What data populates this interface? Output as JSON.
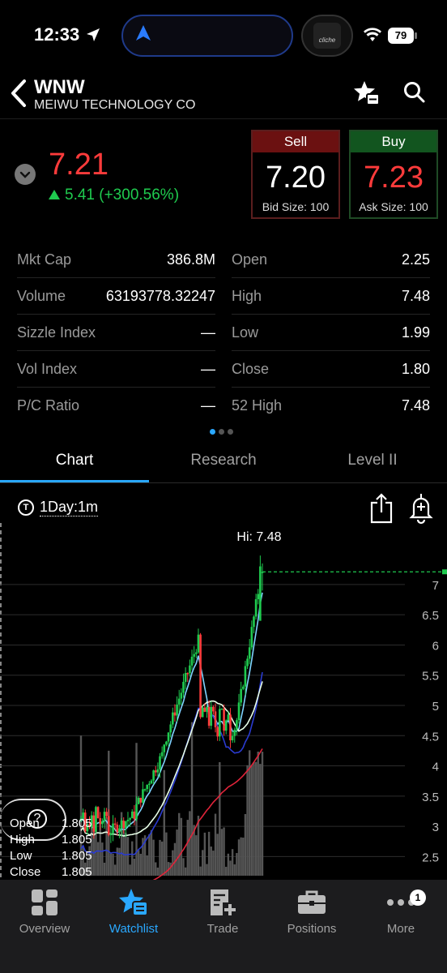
{
  "status_bar": {
    "time": "12:33",
    "battery": "79"
  },
  "header": {
    "symbol": "WNW",
    "company": "MEIWU TECHNOLOGY CO"
  },
  "quote": {
    "last": "7.21",
    "change": "5.41 (+300.56%)",
    "sell": {
      "label": "Sell",
      "price": "7.20",
      "size": "Bid Size: 100"
    },
    "buy": {
      "label": "Buy",
      "price": "7.23",
      "size": "Ask Size: 100"
    }
  },
  "stats": {
    "left": [
      {
        "label": "Mkt Cap",
        "value": "386.8M"
      },
      {
        "label": "Volume",
        "value": "63193778.32247"
      },
      {
        "label": "Sizzle Index",
        "value": "—"
      },
      {
        "label": "Vol Index",
        "value": "—"
      },
      {
        "label": "P/C Ratio",
        "value": "—"
      }
    ],
    "right": [
      {
        "label": "Open",
        "value": "2.25"
      },
      {
        "label": "High",
        "value": "7.48"
      },
      {
        "label": "Low",
        "value": "1.99"
      },
      {
        "label": "Close",
        "value": "1.80"
      },
      {
        "label": "52 High",
        "value": "7.48"
      }
    ],
    "page_dots": {
      "count": 3,
      "active": 1
    }
  },
  "tabs": [
    "Chart",
    "Research",
    "Level II"
  ],
  "chart_toolbar": {
    "timeframe": "1Day:1m",
    "t_icon": "T"
  },
  "chart_data": {
    "type": "candlestick",
    "annotation": "Hi: 7.48",
    "y_ticks": [
      "7",
      "6.5",
      "6",
      "5.5",
      "5",
      "4.5",
      "4",
      "3.5",
      "3",
      "2.5"
    ],
    "ylim": [
      2.25,
      7.75
    ],
    "last_price_line": 7.21,
    "ohlc_readout": [
      {
        "label": "Open",
        "value": "1.805"
      },
      {
        "label": "High",
        "value": "1.805"
      },
      {
        "label": "Low",
        "value": "1.805"
      },
      {
        "label": "Close",
        "value": "1.805"
      }
    ],
    "colors": {
      "up": "#1fcb4f",
      "down": "#ff3b3b",
      "ma_fast": "#7fd3ff",
      "ma_mid": "#2a3bd0",
      "ma_slow": "#e8ffe8",
      "ma_long": "#e0243a",
      "volume": "#555555"
    }
  },
  "nav": {
    "items": [
      {
        "label": "Overview",
        "icon": "overview-grid-icon"
      },
      {
        "label": "Watchlist",
        "icon": "watchlist-star-icon"
      },
      {
        "label": "Trade",
        "icon": "trade-ticket-icon"
      },
      {
        "label": "Positions",
        "icon": "briefcase-icon"
      },
      {
        "label": "More",
        "icon": "more-dots-icon",
        "badge": "1"
      }
    ],
    "active": 1
  }
}
